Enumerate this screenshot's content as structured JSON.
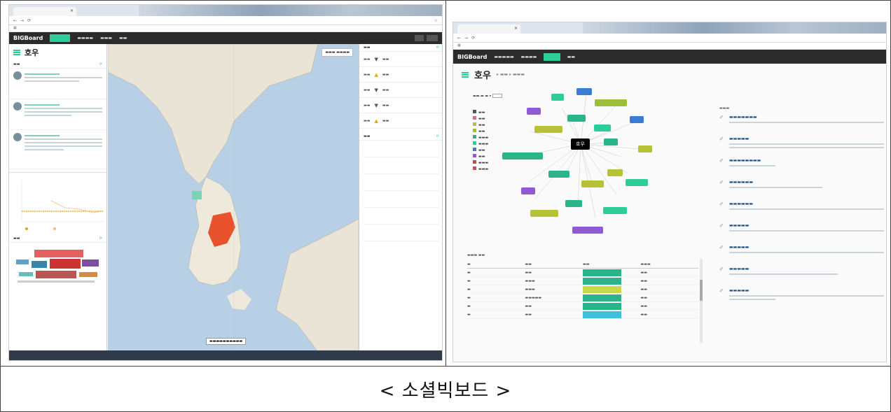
{
  "caption": "< 소셜빅보드 >",
  "left": {
    "app_logo": "BIGBoard",
    "menu_title": "호우"
  },
  "right": {
    "app_logo": "BIGBoard",
    "menu_title": "호우",
    "center_tag": "호우"
  },
  "colors": {
    "accent": "#2ecc99",
    "nav_bg": "#2b2b2b",
    "region_highlight": "#e8532e"
  }
}
